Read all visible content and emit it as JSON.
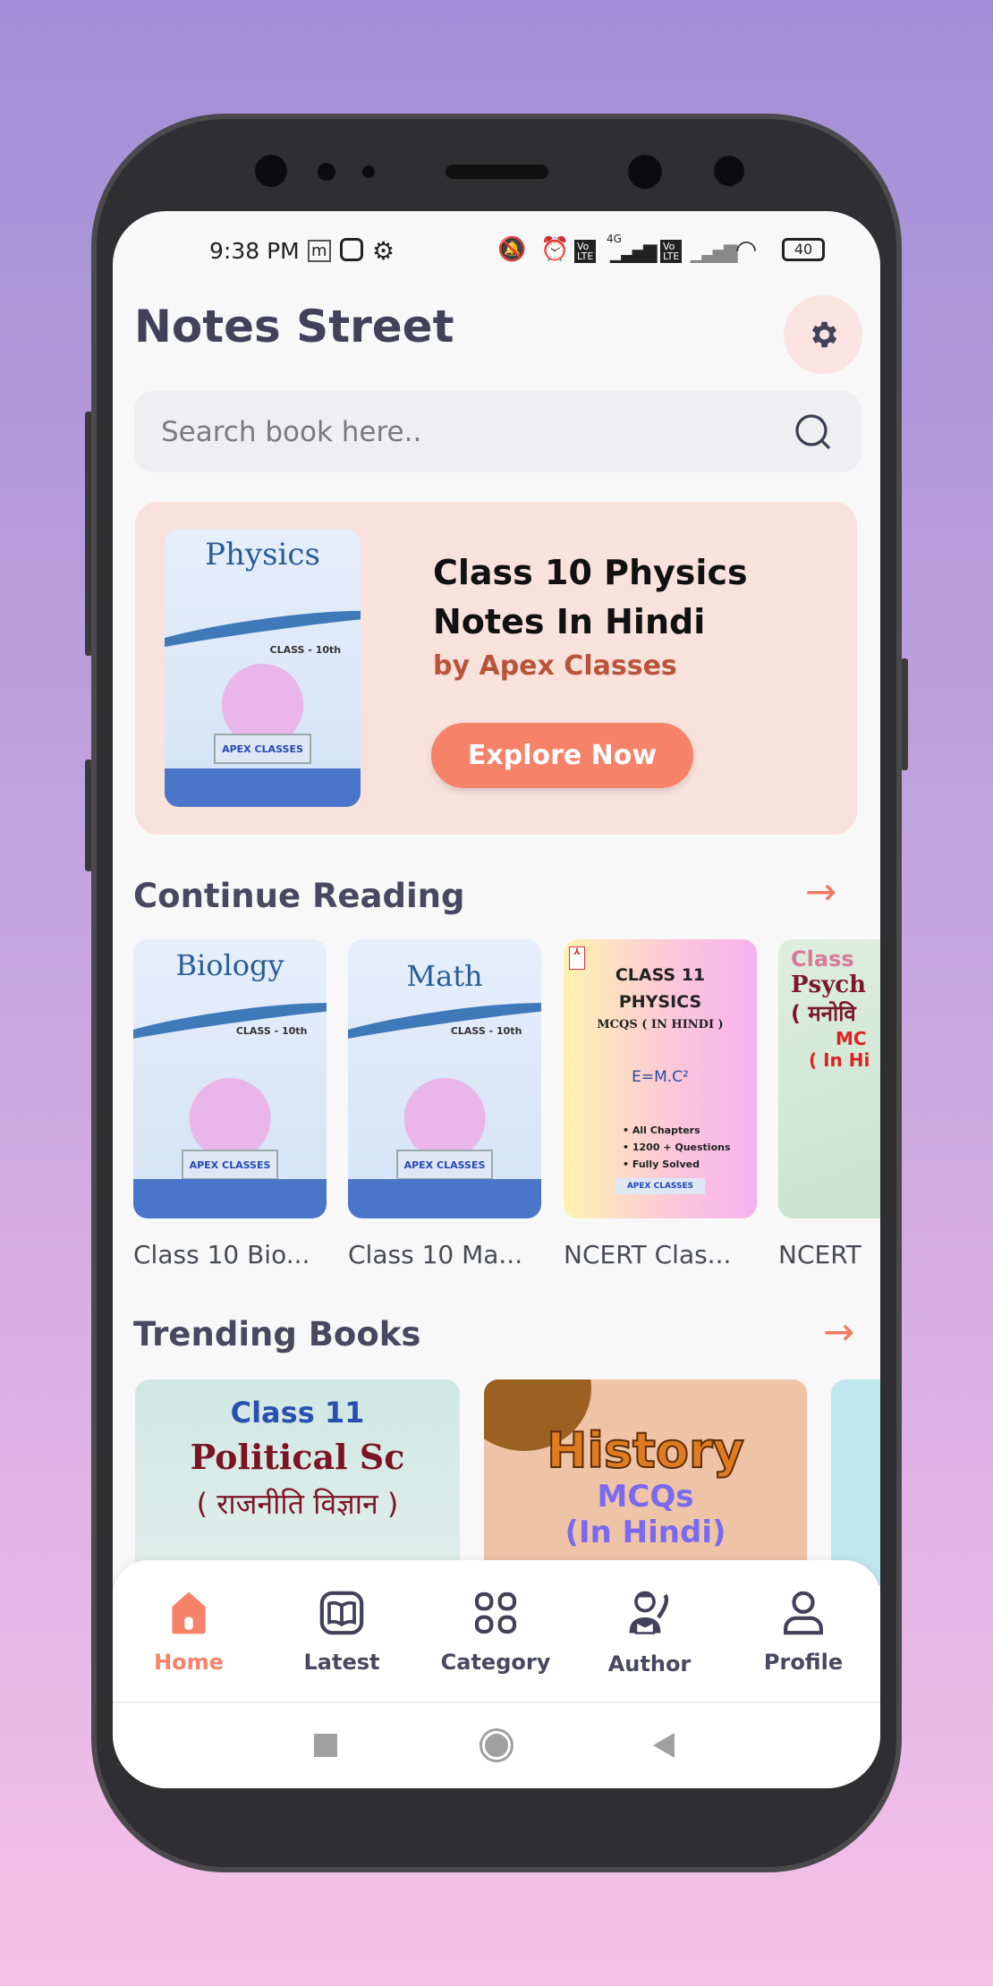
{
  "status_bar": {
    "time": "9:38 PM",
    "network": "4G",
    "battery": "40"
  },
  "app": {
    "title": "Notes Street"
  },
  "search": {
    "placeholder": "Search book here.."
  },
  "banner": {
    "cover_title": "Physics",
    "cover_class": "CLASS - 10th",
    "cover_logo": "APEX CLASSES",
    "title_line1": "Class 10 Physics",
    "title_line2": "Notes In Hindi",
    "author": "by Apex Classes",
    "button": "Explore Now"
  },
  "continue_reading": {
    "heading": "Continue Reading",
    "books": [
      {
        "cover_title": "Biology",
        "cover_class": "CLASS - 10th",
        "cover_logo": "APEX CLASSES",
        "label": "Class 10 Bio..."
      },
      {
        "cover_title": "Math",
        "cover_class": "CLASS - 10th",
        "cover_logo": "APEX CLASSES",
        "label": "Class 10 Ma..."
      },
      {
        "cover_lines": [
          "CLASS 11",
          "PHYSICS",
          "MCQS ( IN HINDI )"
        ],
        "cover_bullets": [
          "• All Chapters",
          "• 1200 + Questions",
          "• Fully Solved"
        ],
        "cover_formula": "E=M.C²",
        "cover_logo": "APEX CLASSES",
        "label": "NCERT Clas..."
      },
      {
        "cover_lines": [
          "Class",
          "Psych",
          "( मनोवि",
          "MC",
          "( In Hi"
        ],
        "label": "NCERT"
      }
    ]
  },
  "trending": {
    "heading": "Trending Books",
    "books": [
      {
        "lines": [
          "Class 11",
          "Political Sc",
          "( राजनीति विज्ञान )"
        ]
      },
      {
        "lines": [
          "History",
          "MCQs",
          "(In Hindi)"
        ]
      },
      {
        "lines": []
      }
    ]
  },
  "bottom_nav": {
    "active": "Home",
    "accent": "#f6826a",
    "items": [
      {
        "label": "Home",
        "icon": "home-icon"
      },
      {
        "label": "Latest",
        "icon": "book-open-icon"
      },
      {
        "label": "Category",
        "icon": "grid-icon"
      },
      {
        "label": "Author",
        "icon": "author-icon"
      },
      {
        "label": "Profile",
        "icon": "user-icon"
      }
    ]
  }
}
